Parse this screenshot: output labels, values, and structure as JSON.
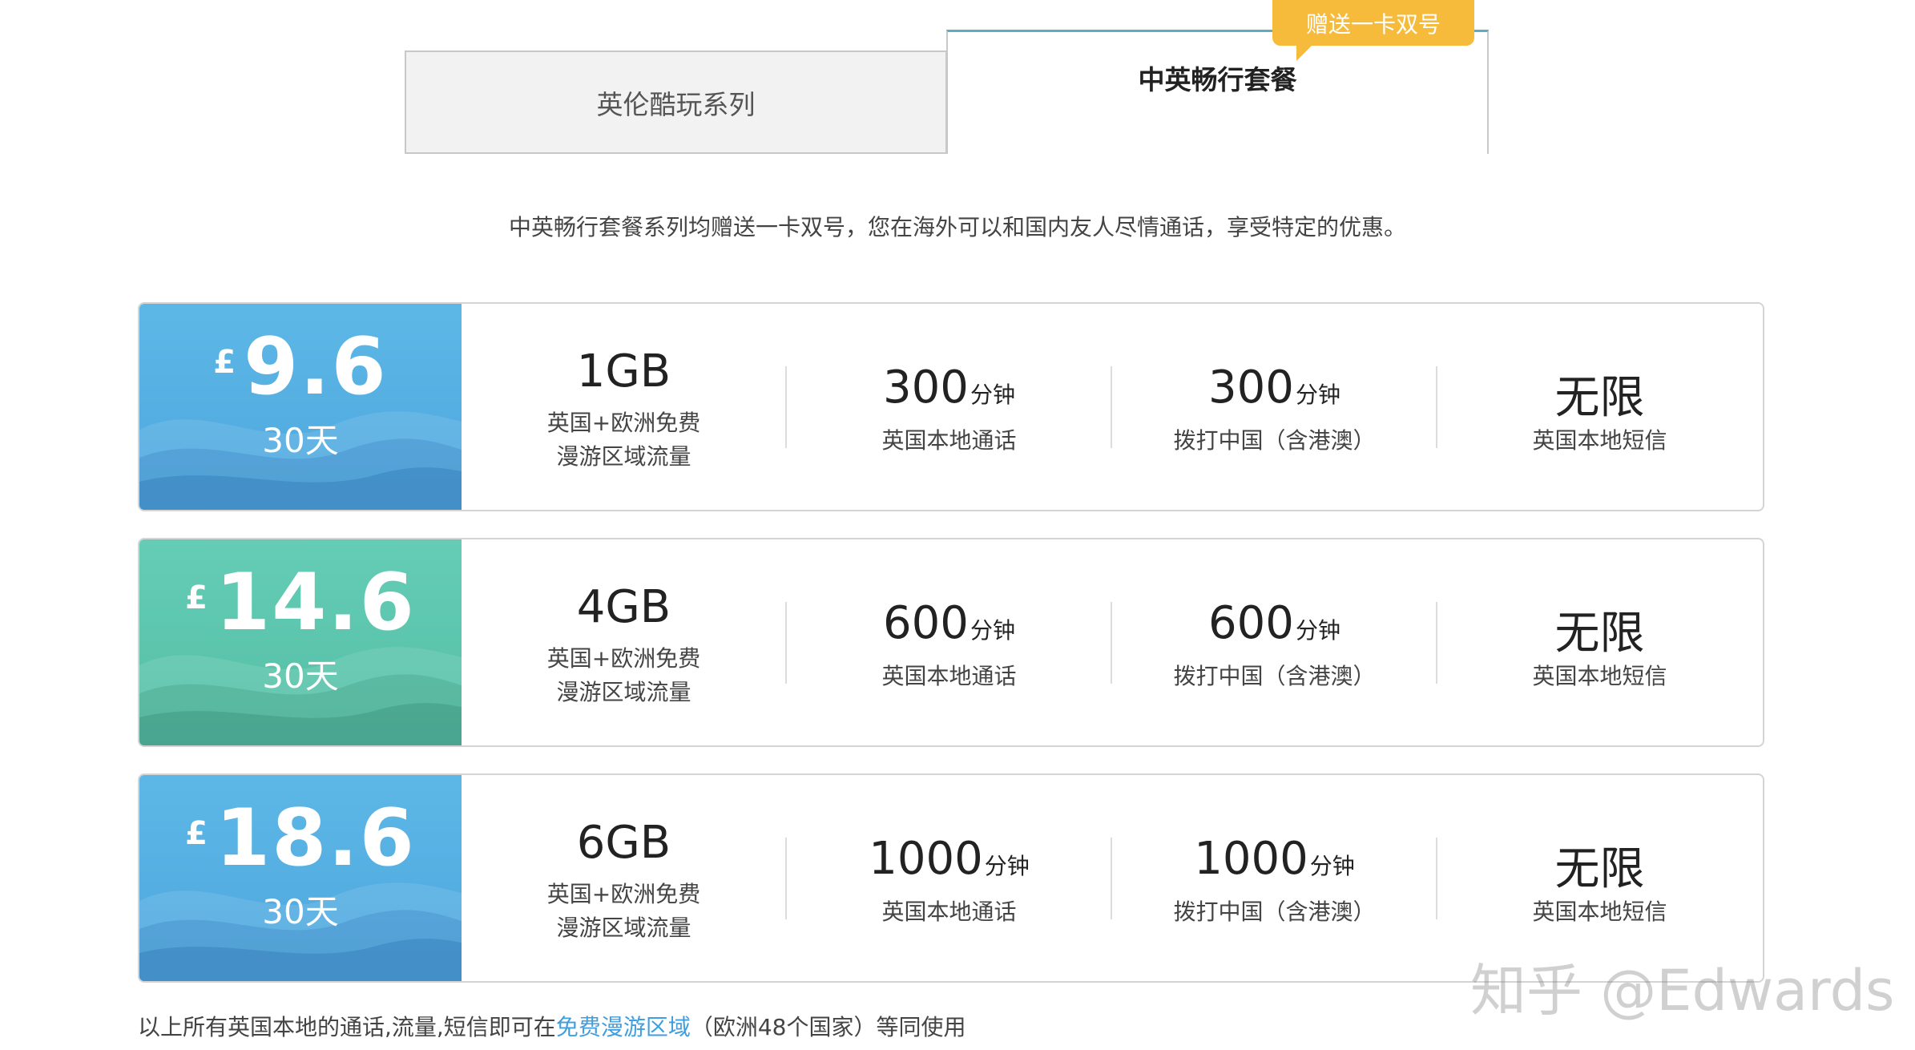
{
  "tabs": {
    "tab1_label": "英伦酷玩系列",
    "tab2_label": "中英畅行套餐",
    "tab2_badge": "赠送一卡双号"
  },
  "intro": "中英畅行套餐系列均赠送一卡双号，您在海外可以和国内友人尽情通话，享受特定的优惠。",
  "plans": [
    {
      "currency": "£",
      "price": "9.6",
      "period": "30天",
      "color": "#5db7e6",
      "data": "1GB",
      "data_desc1": "英国+欧洲免费",
      "data_desc2": "漫游区域流量",
      "local_calls": "300",
      "local_unit": "分钟",
      "local_desc": "英国本地通话",
      "china_calls": "300",
      "china_unit": "分钟",
      "china_desc": "拨打中国（含港澳）",
      "sms": "无限",
      "sms_desc": "英国本地短信"
    },
    {
      "currency": "£",
      "price": "14.6",
      "period": "30天",
      "color": "#65cdb6",
      "data": "4GB",
      "data_desc1": "英国+欧洲免费",
      "data_desc2": "漫游区域流量",
      "local_calls": "600",
      "local_unit": "分钟",
      "local_desc": "英国本地通话",
      "china_calls": "600",
      "china_unit": "分钟",
      "china_desc": "拨打中国（含港澳）",
      "sms": "无限",
      "sms_desc": "英国本地短信"
    },
    {
      "currency": "£",
      "price": "18.6",
      "period": "30天",
      "color": "#5db7e6",
      "data": "6GB",
      "data_desc1": "英国+欧洲免费",
      "data_desc2": "漫游区域流量",
      "local_calls": "1000",
      "local_unit": "分钟",
      "local_desc": "英国本地通话",
      "china_calls": "1000",
      "china_unit": "分钟",
      "china_desc": "拨打中国（含港澳）",
      "sms": "无限",
      "sms_desc": "英国本地短信"
    }
  ],
  "footnote": {
    "prefix": "以上所有英国本地的通话,流量,短信即可在",
    "link": "免费漫游区域",
    "suffix": "（欧洲48个国家）等同使用"
  },
  "watermark": "知乎 @Edwards"
}
